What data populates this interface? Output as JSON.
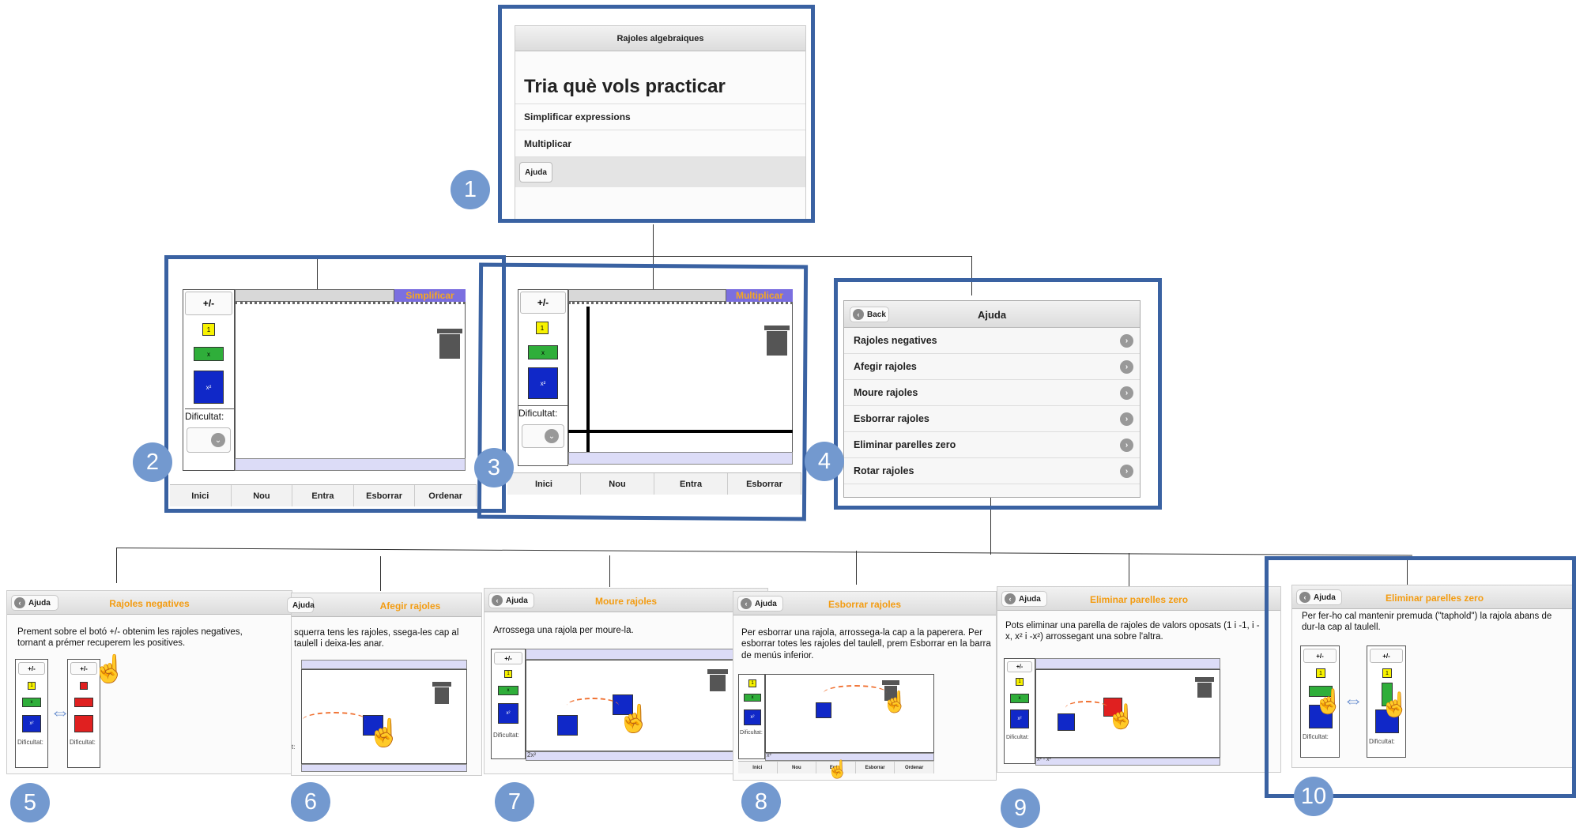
{
  "badges": [
    "1",
    "2",
    "3",
    "4",
    "5",
    "6",
    "7",
    "8",
    "9",
    "10"
  ],
  "s1": {
    "title": "Rajoles algebraiques",
    "heading": "Tria què vols practicar",
    "items": [
      "Simplificar expressions",
      "Multiplicar"
    ],
    "help": "Ajuda"
  },
  "s2": {
    "pm": "+/-",
    "tiles": [
      "1",
      "x",
      "x²"
    ],
    "difficulty": "Dificultat:",
    "mode": "Simplificar",
    "nav": [
      "Inici",
      "Nou",
      "Entra",
      "Esborrar",
      "Ordenar"
    ]
  },
  "s3": {
    "pm": "+/-",
    "tiles": [
      "1",
      "x",
      "x²"
    ],
    "difficulty": "Dificultat:",
    "mode": "Multiplicar",
    "nav": [
      "Inici",
      "Nou",
      "Entra",
      "Esborrar"
    ]
  },
  "s4": {
    "back": "Back",
    "title": "Ajuda",
    "items": [
      "Rajoles negatives",
      "Afegir rajoles",
      "Moure rajoles",
      "Esborrar rajoles",
      "Eliminar parelles zero",
      "Rotar rajoles"
    ]
  },
  "h5": {
    "back": "Ajuda",
    "title": "Rajoles negatives",
    "text": "Prement sobre el botó +/- obtenim les rajoles negatives, tornant a prémer recuperem les positives.",
    "pm": "+/-",
    "difficulty": "Dificultat:",
    "tiles": [
      "1",
      "x",
      "x²"
    ]
  },
  "h6": {
    "back": "Ajuda",
    "title": "Afegir rajoles",
    "text": "squerra tens les rajoles, ssega-les cap al taulell i deixa-les anar.",
    "difficulty": "t:"
  },
  "h7": {
    "back": "Ajuda",
    "title": "Moure rajoles",
    "text": "Arrossega una rajola per moure-la.",
    "pm": "+/-",
    "difficulty": "Dificultat:",
    "tiles": [
      "1",
      "x",
      "x²"
    ],
    "expr": "2x²"
  },
  "h8": {
    "back": "Ajuda",
    "title": "Esborrar rajoles",
    "text": "Per esborrar una rajola, arrossega-la cap a la paperera. Per esborrar totes les rajoles del taulell, prem Esborrar en la barra de menús inferior.",
    "difficulty": "Dificultat:",
    "tiles": [
      "1",
      "x",
      "x²"
    ],
    "expr": "x²",
    "nav": [
      "Inici",
      "Nou",
      "Entra",
      "Esborrar",
      "Ordenar"
    ]
  },
  "h9": {
    "back": "Ajuda",
    "title": "Eliminar parelles zero",
    "text": "Pots eliminar una parella de rajoles de valors oposats (1 i -1, i -x, x² i -x²) arrossegant una sobre l'altra.",
    "pm": "+/-",
    "difficulty": "Dificultat:",
    "tiles": [
      "1",
      "x",
      "x²"
    ],
    "expr": "x² - x²"
  },
  "h10": {
    "back": "Ajuda",
    "title": "Eliminar parelles zero",
    "text": "Per fer-ho cal mantenir premuda (\"taphold\") la rajola abans de dur-la cap al taulell.",
    "pm": "+/-",
    "difficulty": "Dificultat:",
    "tiles": [
      "1"
    ]
  }
}
